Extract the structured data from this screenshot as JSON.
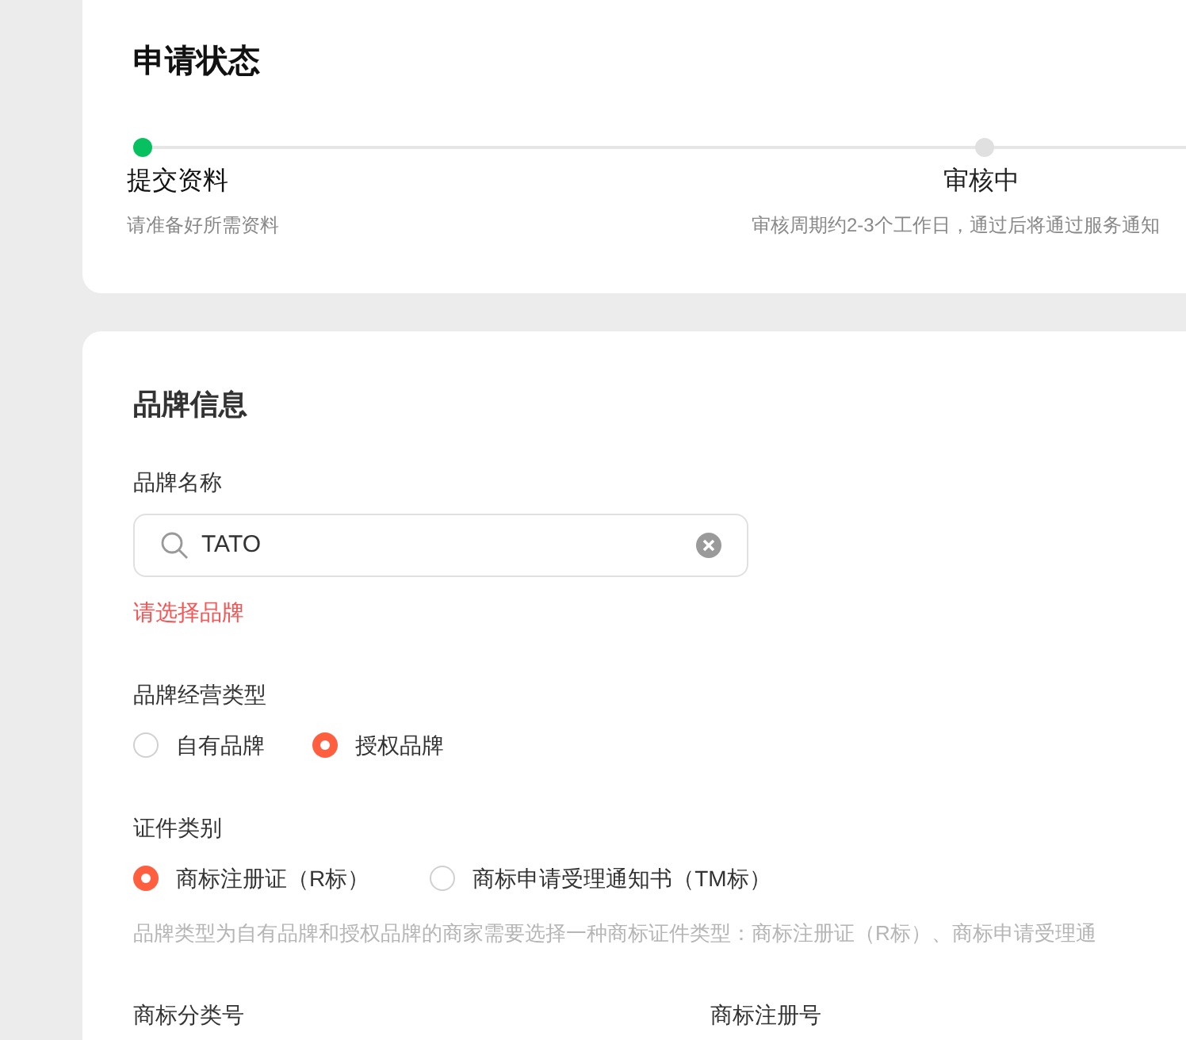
{
  "status_card": {
    "title": "申请状态",
    "steps": [
      {
        "label": "提交资料",
        "description": "请准备好所需资料",
        "selected": true
      },
      {
        "label": "审核中",
        "description": "审核周期约2-3个工作日，通过后将通过服务通知",
        "selected": false
      }
    ]
  },
  "brand_card": {
    "title": "品牌信息",
    "brand_name": {
      "label": "品牌名称",
      "value": "TATO",
      "error": "请选择品牌"
    },
    "operation_type": {
      "label": "品牌经营类型",
      "options": [
        {
          "label": "自有品牌",
          "selected": false
        },
        {
          "label": "授权品牌",
          "selected": true
        }
      ]
    },
    "certificate_type": {
      "label": "证件类别",
      "options": [
        {
          "label": "商标注册证（R标）",
          "selected": true
        },
        {
          "label": "商标申请受理通知书（TM标）",
          "selected": false
        }
      ],
      "hint": "品牌类型为自有品牌和授权品牌的商家需要选择一种商标证件类型：商标注册证（R标）、商标申请受理通"
    },
    "bottom_labels": [
      "商标分类号",
      "商标注册号"
    ]
  }
}
